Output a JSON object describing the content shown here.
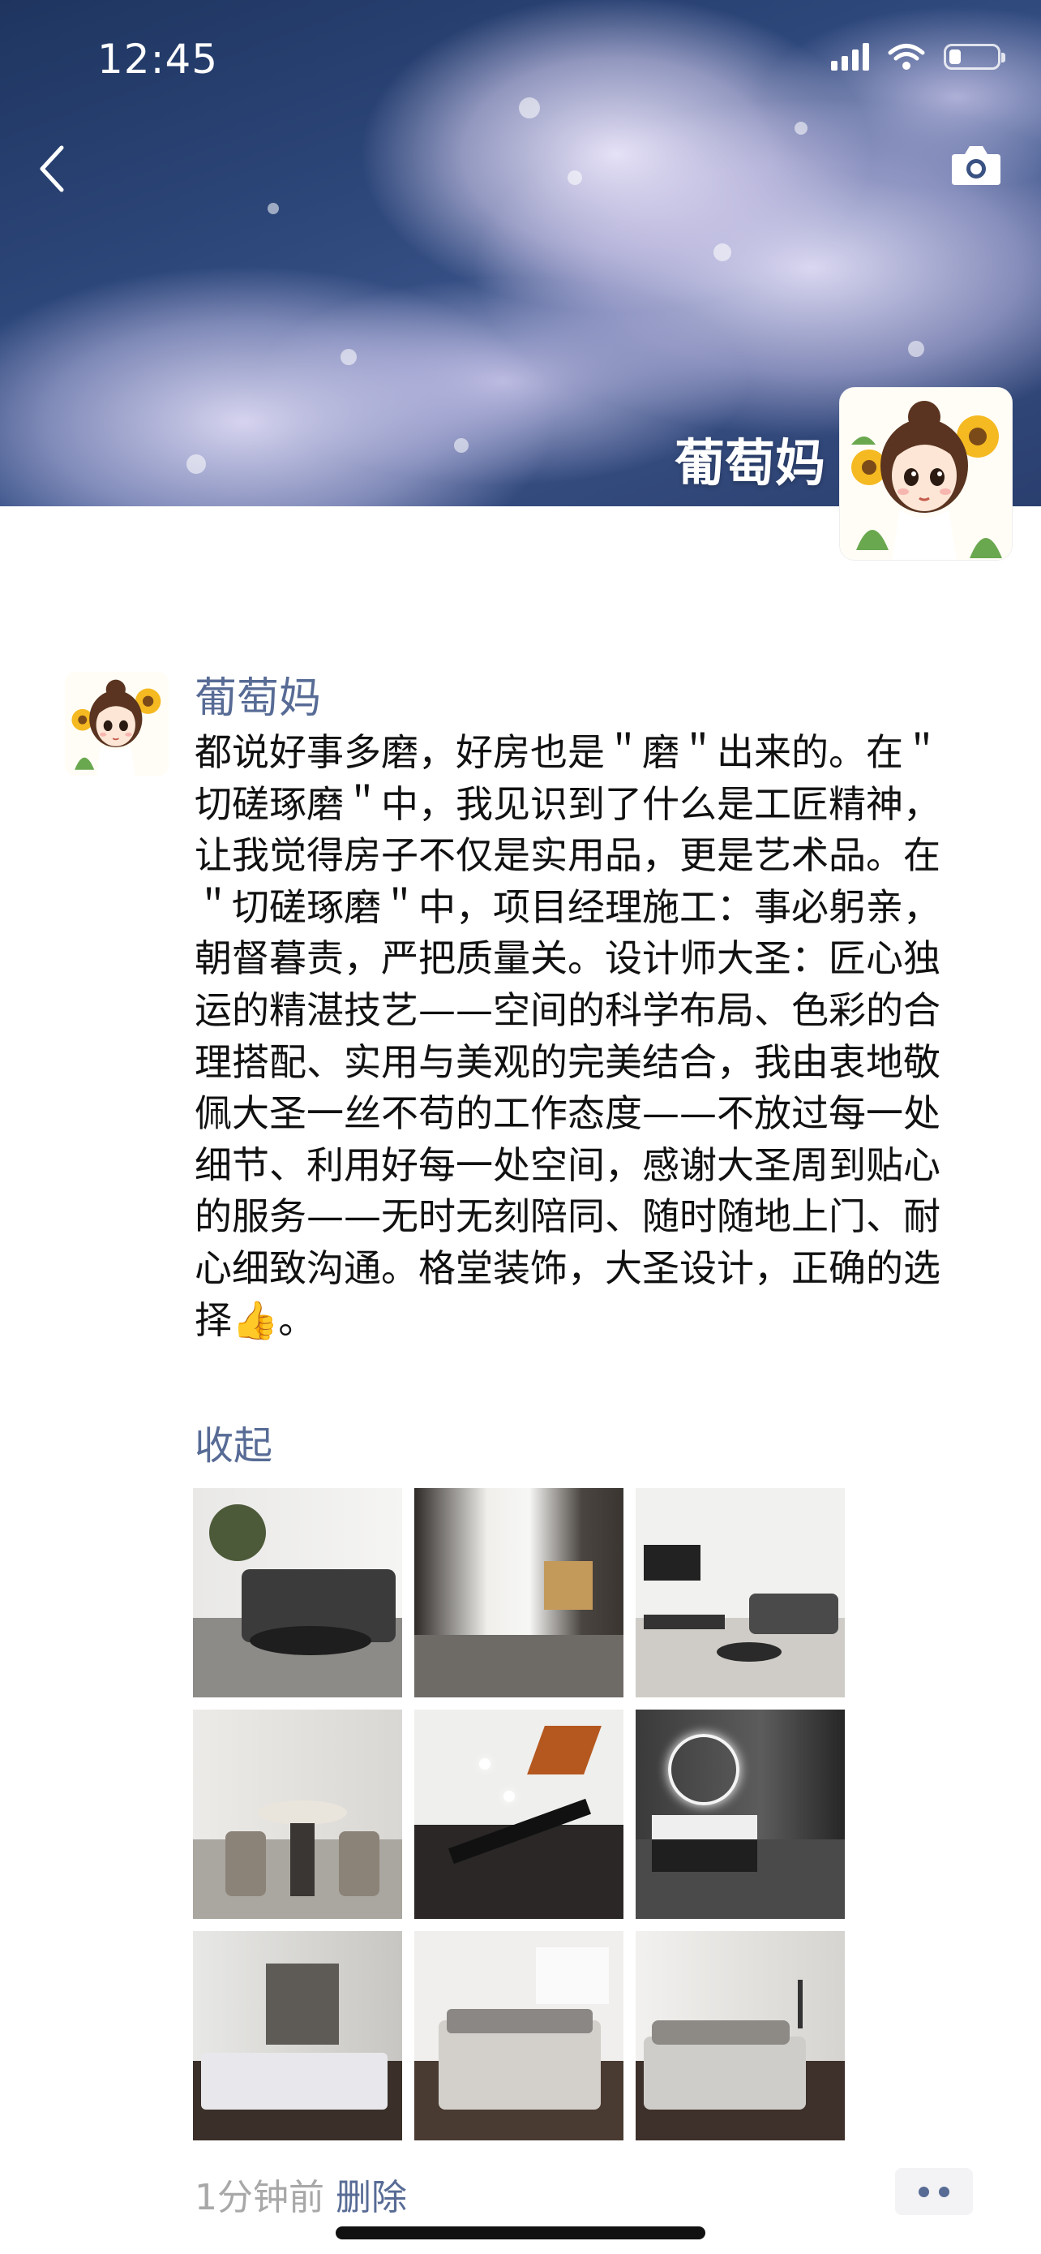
{
  "status_bar": {
    "time": "12:45",
    "battery_level": 0.2
  },
  "header": {
    "back_icon": "chevron-left-icon",
    "camera_icon": "camera-icon"
  },
  "cover": {
    "user_name": "葡萄妈"
  },
  "post": {
    "author": "葡萄妈",
    "text": "都说好事多磨，好房也是＂磨＂出来的。在＂切磋琢磨＂中，我见识到了什么是工匠精神，让我觉得房子不仅是实用品，更是艺术品。在＂切磋琢磨＂中，项目经理施工：事必躬亲，朝督暮责，严把质量关。设计师大圣：匠心独运的精湛技艺——空间的科学布局、色彩的合理搭配、实用与美观的完美结合，我由衷地敬佩大圣一丝不苟的工作态度——不放过每一处细节、利用好每一处空间，感谢大圣周到贴心的服务——无时无刻陪同、随时随地上门、耐心细致沟通。格堂装饰，大圣设计，正确的选择👍。",
    "collapse_label": "收起",
    "photo_count": 9,
    "time_ago": "1分钟前",
    "delete_label": "删除"
  },
  "colors": {
    "link": "#576b95",
    "text": "#111111",
    "muted": "#a8a8a8"
  }
}
